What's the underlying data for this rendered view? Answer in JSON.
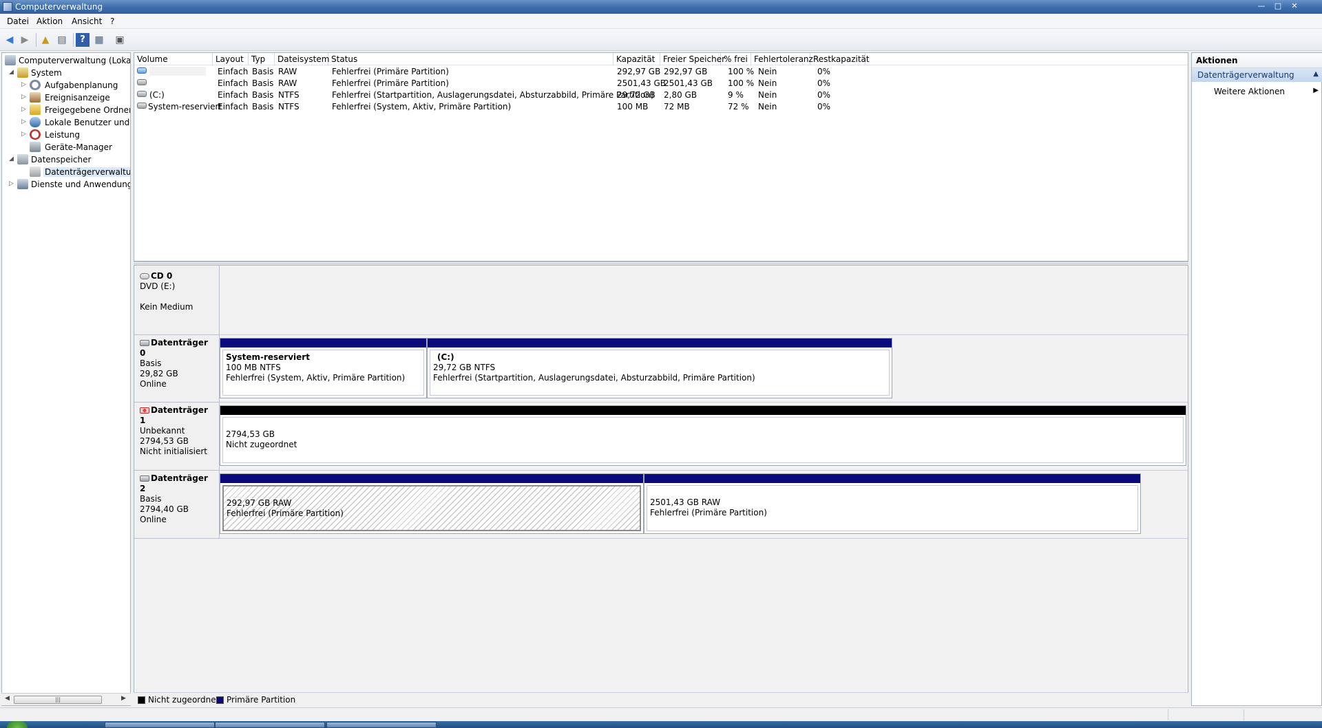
{
  "window": {
    "title": "Computerverwaltung"
  },
  "menu": {
    "items": [
      "Datei",
      "Aktion",
      "Ansicht",
      "?"
    ]
  },
  "toolbar": {
    "buttons": [
      "back-icon",
      "forward-icon",
      "up-folder-icon",
      "show-hide-tree-icon",
      "help-icon",
      "show-hide-action-icon",
      "properties-icon"
    ]
  },
  "tree": {
    "root": "Computerverwaltung (Lokal)",
    "system": "System",
    "aufgabenplanung": "Aufgabenplanung",
    "ereignisanzeige": "Ereignisanzeige",
    "freigegebene_ordner": "Freigegebene Ordner",
    "lokale_benutzer": "Lokale Benutzer und Gr",
    "leistung": "Leistung",
    "geraete_manager": "Geräte-Manager",
    "datenspeicher": "Datenspeicher",
    "datentraegerverwaltung": "Datenträgerverwaltung",
    "dienste": "Dienste und Anwendungen"
  },
  "volumes": {
    "headers": {
      "volume": "Volume",
      "layout": "Layout",
      "typ": "Typ",
      "dateisystem": "Dateisystem",
      "status": "Status",
      "kapazitaet": "Kapazität",
      "freier_speicher": "Freier Speicher",
      "prozent_frei": "% frei",
      "fehlertoleranz": "Fehlertoleranz",
      "restkapazitaet": "Restkapazität"
    },
    "rows": [
      {
        "volume": "",
        "layout": "Einfach",
        "typ": "Basis",
        "dateisystem": "RAW",
        "status": "Fehlerfrei (Primäre Partition)",
        "kapazitaet": "292,97 GB",
        "frei": "292,97 GB",
        "prozent": "100 %",
        "fehlertoleranz": "Nein",
        "rest": "0%"
      },
      {
        "volume": "",
        "layout": "Einfach",
        "typ": "Basis",
        "dateisystem": "RAW",
        "status": "Fehlerfrei (Primäre Partition)",
        "kapazitaet": "2501,43 GB",
        "frei": "2501,43 GB",
        "prozent": "100 %",
        "fehlertoleranz": "Nein",
        "rest": "0%"
      },
      {
        "volume": "(C:)",
        "layout": "Einfach",
        "typ": "Basis",
        "dateisystem": "NTFS",
        "status": "Fehlerfrei (Startpartition, Auslagerungsdatei, Absturzabbild, Primäre Partition)",
        "kapazitaet": "29,72 GB",
        "frei": "2,80 GB",
        "prozent": "9 %",
        "fehlertoleranz": "Nein",
        "rest": "0%"
      },
      {
        "volume": "System-reserviert",
        "layout": "Einfach",
        "typ": "Basis",
        "dateisystem": "NTFS",
        "status": "Fehlerfrei (System, Aktiv, Primäre Partition)",
        "kapazitaet": "100 MB",
        "frei": "72 MB",
        "prozent": "72 %",
        "fehlertoleranz": "Nein",
        "rest": "0%"
      }
    ]
  },
  "disks": {
    "cd0": {
      "name": "CD 0",
      "line1": "DVD (E:)",
      "line2": "",
      "line3": "Kein Medium"
    },
    "disk0": {
      "name": "Datenträger 0",
      "line1": "Basis",
      "line2": "29,82 GB",
      "line3": "Online",
      "p1": {
        "title": "System-reserviert",
        "size": "100 MB NTFS",
        "status": "Fehlerfrei (System, Aktiv, Primäre Partition)"
      },
      "p2": {
        "title": "(C:)",
        "size": "29,72 GB NTFS",
        "status": "Fehlerfrei (Startpartition, Auslagerungsdatei, Absturzabbild, Primäre Partition)"
      }
    },
    "disk1": {
      "name": "Datenträger 1",
      "line1": "Unbekannt",
      "line2": "2794,53 GB",
      "line3": "Nicht initialisiert",
      "p1": {
        "size": "2794,53 GB",
        "status": "Nicht zugeordnet"
      }
    },
    "disk2": {
      "name": "Datenträger 2",
      "line1": "Basis",
      "line2": "2794,40 GB",
      "line3": "Online",
      "p1": {
        "size": "292,97 GB RAW",
        "status": "Fehlerfrei (Primäre Partition)"
      },
      "p2": {
        "size": "2501,43 GB RAW",
        "status": "Fehlerfrei (Primäre Partition)"
      }
    }
  },
  "legend": {
    "unallocated": "Nicht zugeordnet",
    "primary": "Primäre Partition",
    "unallocated_color": "#000000",
    "primary_color": "#0a0a7d"
  },
  "actions": {
    "title": "Aktionen",
    "group": "Datenträgerverwaltung",
    "more": "Weitere Aktionen"
  }
}
